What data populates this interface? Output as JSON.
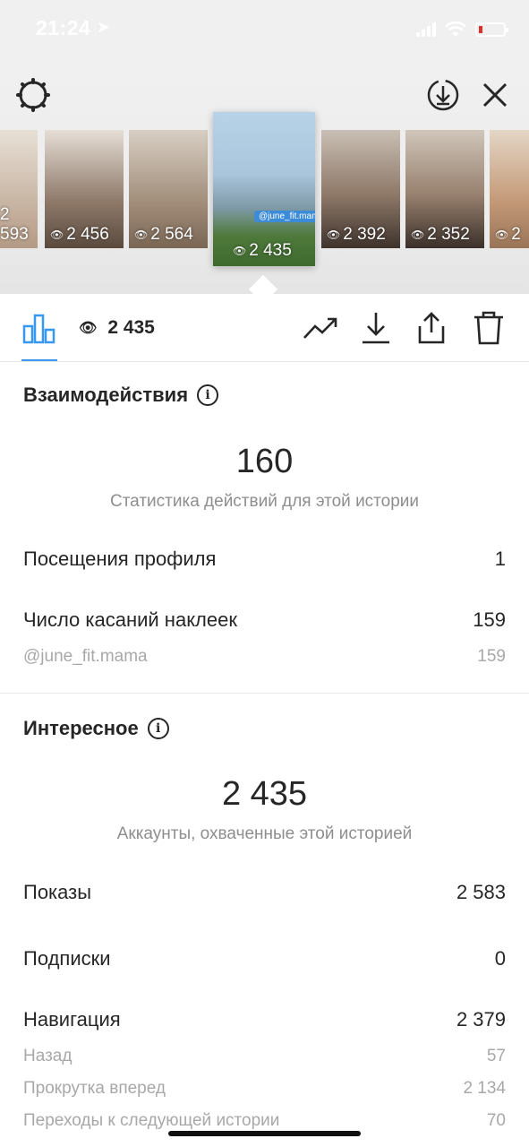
{
  "status": {
    "time": "21:24",
    "location_icon": "location-arrow-icon"
  },
  "top_bar": {
    "settings_icon": "gear-icon",
    "download_icon": "download-circle-icon",
    "close_icon": "close-icon"
  },
  "thumbnails": [
    {
      "views": "2 593",
      "bg": "#c9b9a6"
    },
    {
      "views": "2 456",
      "bg": "#a89a8c"
    },
    {
      "views": "2 564",
      "bg": "#b6a391"
    },
    {
      "views": "2 435",
      "bg": "#8fb3c9",
      "tag": "@june_fit.mama"
    },
    {
      "views": "2 392",
      "bg": "#9c8a7e"
    },
    {
      "views": "2 352",
      "bg": "#9b8878"
    },
    {
      "views": "2",
      "bg": "#c7a88a"
    }
  ],
  "toolbar": {
    "views": "2 435"
  },
  "interactions": {
    "title": "Взаимодействия",
    "total": "160",
    "caption": "Статистика действий для этой истории",
    "rows": [
      {
        "label": "Посещения профиля",
        "value": "1"
      },
      {
        "label": "Число касаний наклеек",
        "value": "159"
      }
    ],
    "sub_rows": [
      {
        "label": "@june_fit.mama",
        "value": "159"
      }
    ]
  },
  "discovery": {
    "title": "Интересное",
    "total": "2 435",
    "caption": "Аккаунты, охваченные этой историей",
    "rows": [
      {
        "label": "Показы",
        "value": "2 583"
      },
      {
        "label": "Подписки",
        "value": "0"
      },
      {
        "label": "Навигация",
        "value": "2 379"
      }
    ],
    "sub_rows": [
      {
        "label": "Назад",
        "value": "57"
      },
      {
        "label": "Прокрутка вперед",
        "value": "2 134"
      },
      {
        "label": "Переходы к следующей истории",
        "value": "70"
      }
    ]
  }
}
